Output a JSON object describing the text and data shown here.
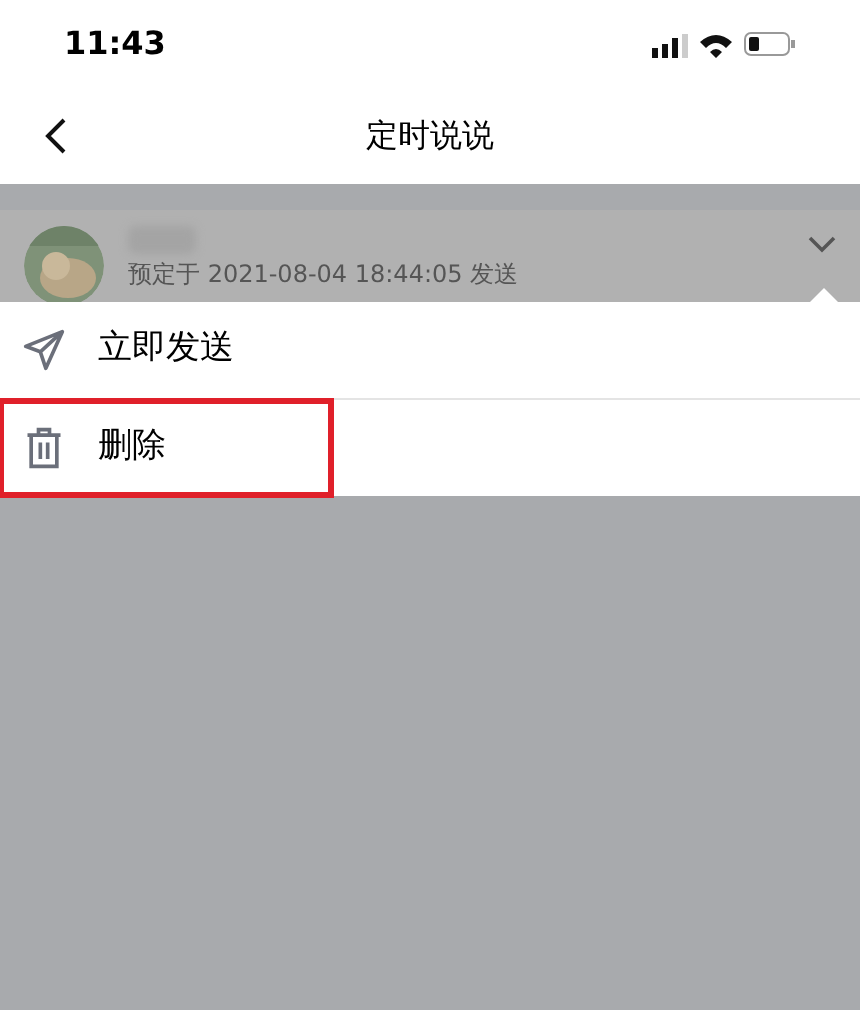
{
  "status_bar": {
    "time": "11:43"
  },
  "nav": {
    "title": "定时说说"
  },
  "post": {
    "schedule": "预定于 2021-08-04 18:44:05 发送"
  },
  "menu": [
    {
      "kind": "send",
      "label": "立即发送",
      "highlighted": false
    },
    {
      "kind": "delete",
      "label": "删除",
      "highlighted": true
    }
  ]
}
